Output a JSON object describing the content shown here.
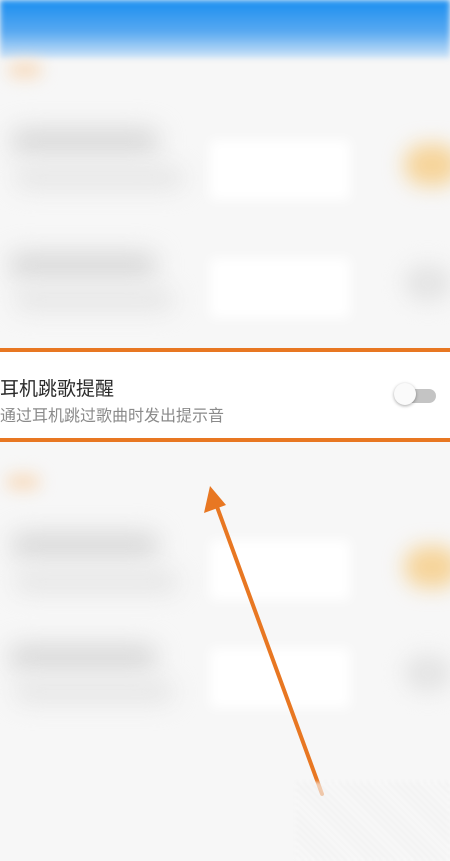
{
  "setting": {
    "title": "耳机跳歌提醒",
    "description": "通过耳机跳过歌曲时发出提示音",
    "enabled": false
  },
  "colors": {
    "highlight": "#e87722",
    "top_bar": "#1a8ef0",
    "toggle_off_track": "#c4c4c4"
  }
}
